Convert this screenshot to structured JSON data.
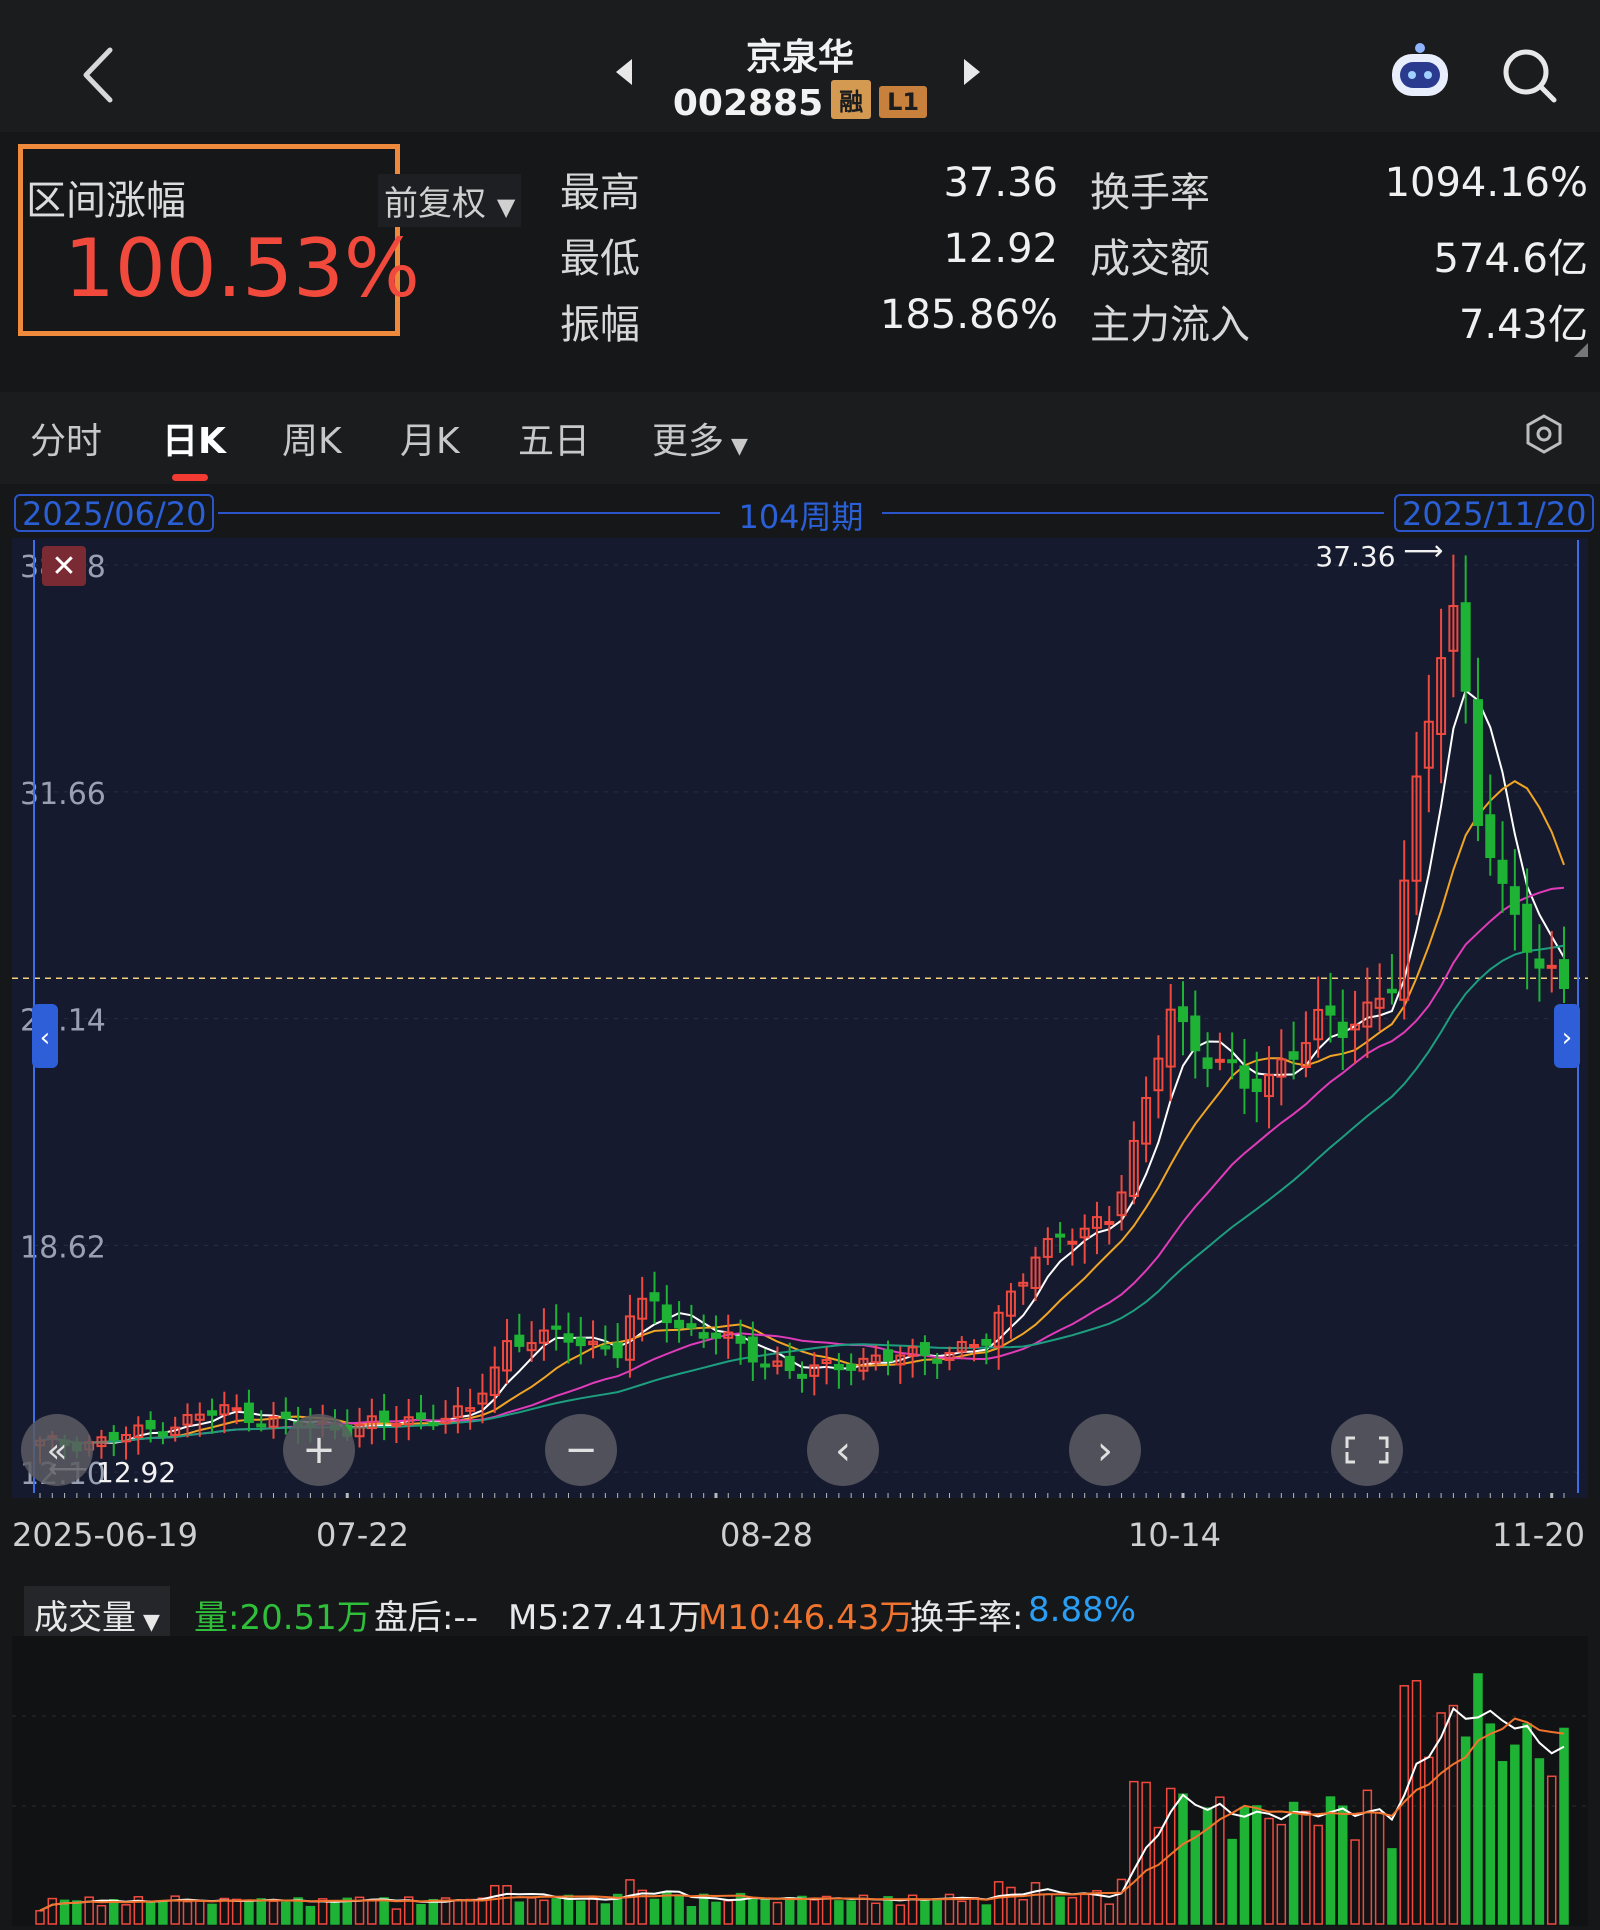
{
  "header": {
    "name": "京泉华",
    "code": "002885",
    "tag_margin": "融",
    "tag_level": "L1"
  },
  "summary": {
    "range_label": "区间涨幅",
    "range_value": "100.53%",
    "adjust_label": "前复权",
    "stats": [
      {
        "label": "最高",
        "value": "37.36",
        "label2": "换手率",
        "value2": "1094.16%"
      },
      {
        "label": "最低",
        "value": "12.92",
        "label2": "成交额",
        "value2": "574.6亿"
      },
      {
        "label": "振幅",
        "value": "185.86%",
        "label2": "主力流入",
        "value2": "7.43亿"
      }
    ]
  },
  "tabs": [
    "分时",
    "日K",
    "周K",
    "月K",
    "五日",
    "更多"
  ],
  "active_tab": "日K",
  "period": {
    "start": "2025/06/20",
    "end": "2025/11/20",
    "label": "104周期"
  },
  "chart_data": {
    "type": "candlestick",
    "y_ticks": [
      "38.18",
      "31.66",
      "25.14",
      "18.62",
      "12.10"
    ],
    "y_tick_values": [
      38.18,
      31.66,
      25.14,
      18.62,
      12.1
    ],
    "ylim": [
      11.5,
      38.9
    ],
    "high_label": "37.36",
    "low_label": "12.92",
    "current_price_line": 26.3,
    "x_ticks": [
      "2025-06-19",
      "07-22",
      "08-28",
      "10-14",
      "11-20"
    ],
    "colors": {
      "up": "#f04a3f",
      "down": "#1fb336",
      "ma5": "#ffffff",
      "ma10": "#f0a526",
      "ma20": "#e03bb8",
      "ma30": "#1d9e7f"
    },
    "close_anchors": [
      [
        0,
        12.9
      ],
      [
        5,
        13.0
      ],
      [
        10,
        13.4
      ],
      [
        15,
        13.9
      ],
      [
        20,
        13.5
      ],
      [
        25,
        13.4
      ],
      [
        30,
        13.6
      ],
      [
        35,
        13.8
      ],
      [
        38,
        15.8
      ],
      [
        40,
        16.0
      ],
      [
        44,
        15.9
      ],
      [
        47,
        15.6
      ],
      [
        48,
        16.5
      ],
      [
        50,
        17.0
      ],
      [
        52,
        16.3
      ],
      [
        55,
        16.0
      ],
      [
        58,
        15.5
      ],
      [
        62,
        14.9
      ],
      [
        66,
        15.3
      ],
      [
        70,
        15.4
      ],
      [
        74,
        15.6
      ],
      [
        77,
        15.8
      ],
      [
        79,
        17.2
      ],
      [
        81,
        18.5
      ],
      [
        84,
        18.8
      ],
      [
        87,
        19.5
      ],
      [
        90,
        22.5
      ],
      [
        92,
        25.5
      ],
      [
        94,
        24.3
      ],
      [
        96,
        24.0
      ],
      [
        98,
        23.0
      ],
      [
        100,
        23.5
      ],
      [
        102,
        24.3
      ],
      [
        104,
        25.0
      ],
      [
        106,
        24.8
      ],
      [
        108,
        25.5
      ],
      [
        110,
        26.2
      ],
      [
        112,
        31.5
      ],
      [
        114,
        36.0
      ],
      [
        115,
        37.0
      ],
      [
        116,
        34.5
      ],
      [
        117,
        31.0
      ],
      [
        119,
        28.5
      ],
      [
        121,
        27.5
      ],
      [
        122,
        26.8
      ],
      [
        123,
        26.5
      ],
      [
        124,
        26.1
      ]
    ]
  },
  "volume": {
    "selector_label": "成交量",
    "vol": "量:20.51万",
    "after": "盘后:--",
    "m5": "M5:27.41万",
    "m10": "M10:46.43万",
    "turnover_label": "换手率:",
    "turnover_value": "8.88%"
  }
}
